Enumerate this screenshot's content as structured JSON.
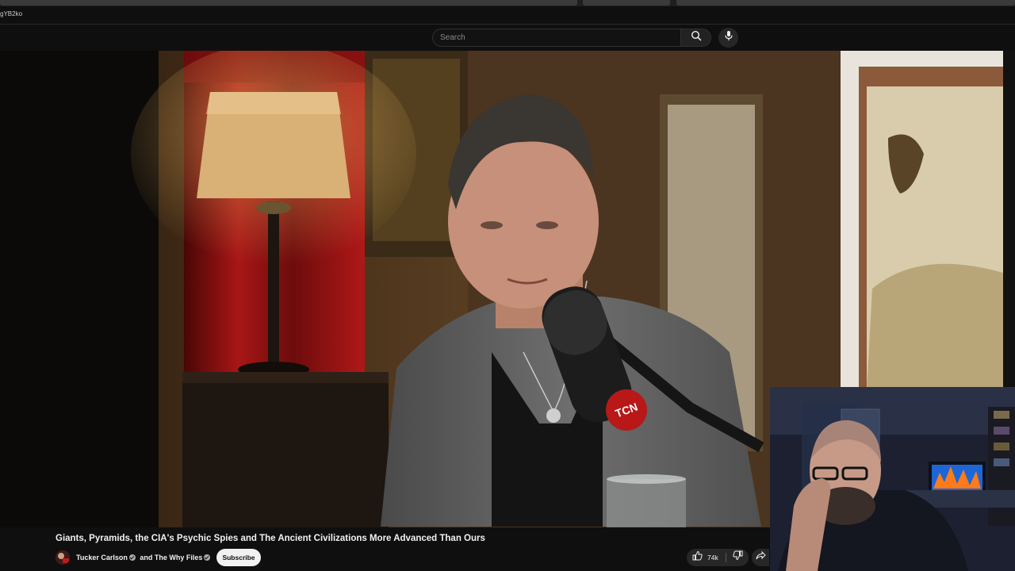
{
  "browser": {
    "url_fragment": "gYB2ko"
  },
  "masthead": {
    "search_placeholder": "Search",
    "search_icon": "search-icon",
    "mic_icon": "mic-icon"
  },
  "video": {
    "title": "Giants, Pyramids, the CIA's Psychic Spies and The Ancient Civilizations More Advanced Than Ours",
    "mic_logo_text": "TCN"
  },
  "owner": {
    "channel_1": "Tucker Carlson",
    "joiner": "and",
    "channel_2": "The Why Files",
    "subscribe_label": "Subscribe"
  },
  "actions": {
    "like_count": "74k",
    "like_icon": "thumbs-up-icon",
    "dislike_icon": "thumbs-down-icon",
    "share_icon": "share-icon"
  },
  "colors": {
    "background": "#0f0f0f",
    "text": "#f1f1f1",
    "pill": "#272727",
    "curtain_red": "#8e1212"
  }
}
